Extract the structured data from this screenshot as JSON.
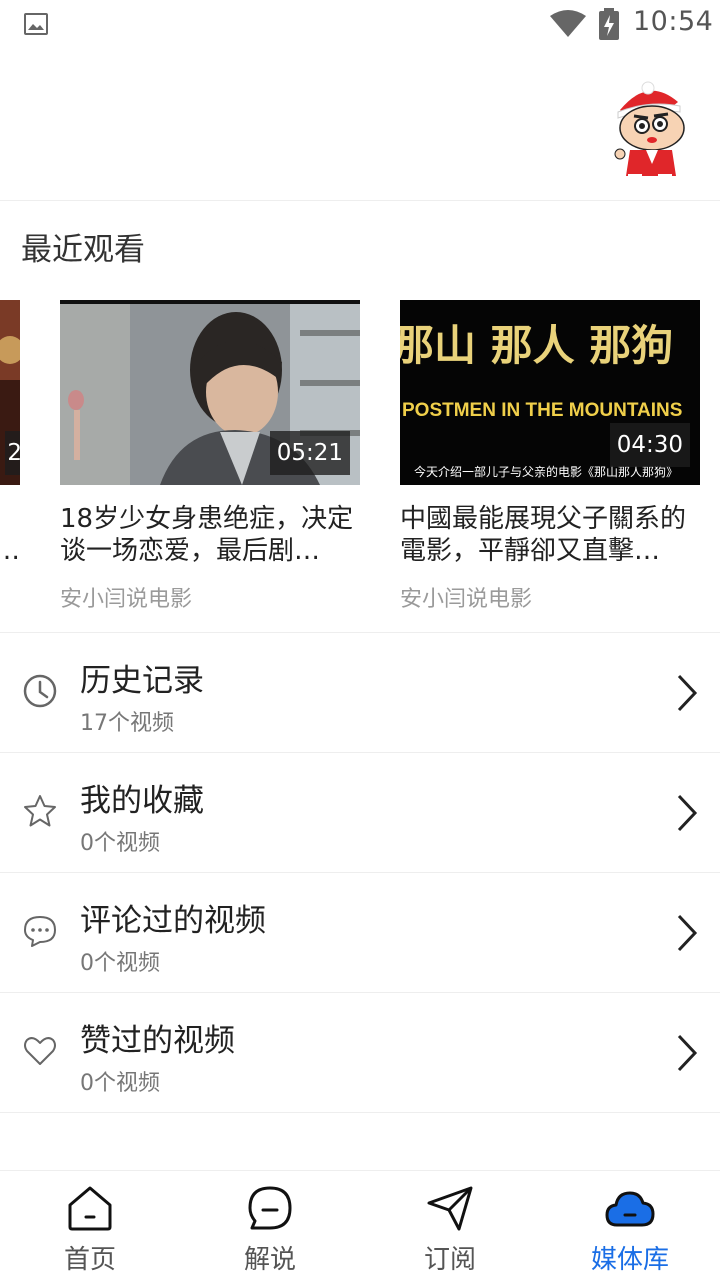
{
  "status_bar": {
    "time": "10:54"
  },
  "recent": {
    "title": "最近观看",
    "partial_card": {
      "duration_fragment": "2",
      "title_fragment": "…"
    },
    "items": [
      {
        "title": "18岁少女身患绝症，决定谈一场恋爱，最后剧…",
        "author": "安小闫说电影",
        "duration": "05:21"
      },
      {
        "title": "中國最能展現父子關系的電影，平靜卻又直擊…",
        "author": "安小闫说电影",
        "duration": "04:30",
        "thumb_text_top": "那山 那人 那狗",
        "thumb_text_mid": "POSTMEN IN THE MOUNTAINS",
        "thumb_text_sub": "今天介绍一部儿子与父亲的电影《那山那人那狗》"
      }
    ]
  },
  "library": {
    "items": [
      {
        "title": "历史记录",
        "count": "17个视频",
        "icon": "clock-icon"
      },
      {
        "title": "我的收藏",
        "count": "0个视频",
        "icon": "star-icon"
      },
      {
        "title": "评论过的视频",
        "count": "0个视频",
        "icon": "comment-icon"
      },
      {
        "title": "赞过的视频",
        "count": "0个视频",
        "icon": "heart-icon"
      }
    ]
  },
  "bottom_nav": {
    "items": [
      {
        "label": "首页",
        "icon": "home-icon"
      },
      {
        "label": "解说",
        "icon": "chat-icon"
      },
      {
        "label": "订阅",
        "icon": "send-icon"
      },
      {
        "label": "媒体库",
        "icon": "cloud-icon",
        "active": true
      }
    ]
  },
  "colors": {
    "accent": "#1a6ee6",
    "text": "#222222",
    "muted": "#9a9a9a",
    "divider": "#eeeeee"
  }
}
